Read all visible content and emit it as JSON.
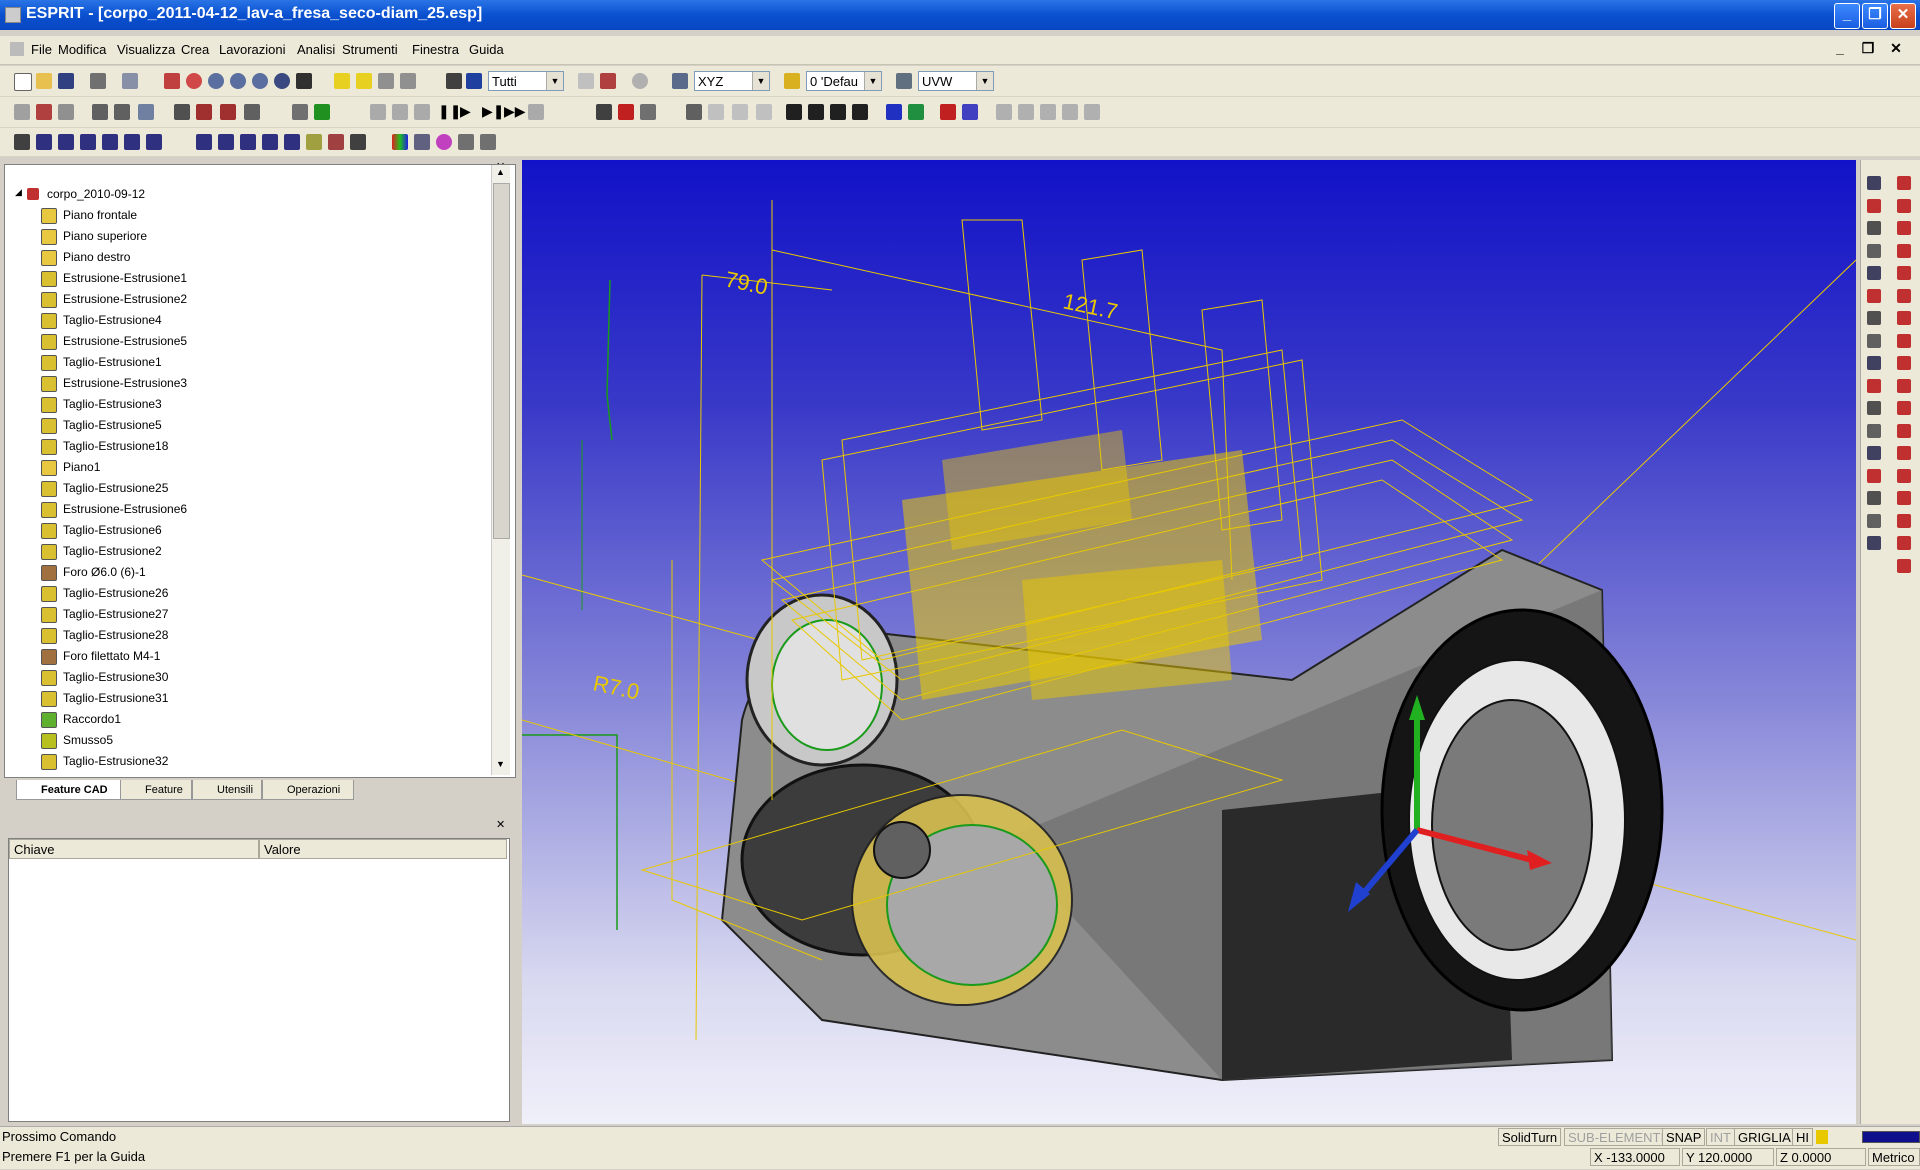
{
  "window": {
    "title": "ESPRIT - [corpo_2011-04-12_lav-a_fresa_seco-diam_25.esp]"
  },
  "menu": [
    "File",
    "Modifica",
    "Visualizza",
    "Crea",
    "Lavorazioni",
    "Analisi",
    "Strumenti",
    "Finestra",
    "Guida"
  ],
  "toolbar": {
    "selection_filter": "Tutti",
    "work_plane": "XYZ",
    "layer": "0 'Defau",
    "uvw": "UVW"
  },
  "tree": {
    "root": "corpo_2010-09-12",
    "items": [
      {
        "label": "Piano frontale",
        "icon": "plane-icon"
      },
      {
        "label": "Piano superiore",
        "icon": "plane-icon"
      },
      {
        "label": "Piano destro",
        "icon": "plane-icon"
      },
      {
        "label": "Estrusione-Estrusione1",
        "icon": "extrude-icon"
      },
      {
        "label": "Estrusione-Estrusione2",
        "icon": "extrude-icon"
      },
      {
        "label": "Taglio-Estrusione4",
        "icon": "cut-extrude-icon"
      },
      {
        "label": "Estrusione-Estrusione5",
        "icon": "extrude-icon"
      },
      {
        "label": "Taglio-Estrusione1",
        "icon": "cut-extrude-icon"
      },
      {
        "label": "Estrusione-Estrusione3",
        "icon": "extrude-icon"
      },
      {
        "label": "Taglio-Estrusione3",
        "icon": "cut-extrude-icon"
      },
      {
        "label": "Taglio-Estrusione5",
        "icon": "cut-extrude-icon"
      },
      {
        "label": "Taglio-Estrusione18",
        "icon": "cut-extrude-icon"
      },
      {
        "label": "Piano1",
        "icon": "plane-icon"
      },
      {
        "label": "Taglio-Estrusione25",
        "icon": "cut-extrude-icon"
      },
      {
        "label": "Estrusione-Estrusione6",
        "icon": "extrude-icon"
      },
      {
        "label": "Taglio-Estrusione6",
        "icon": "cut-extrude-icon"
      },
      {
        "label": "Taglio-Estrusione2",
        "icon": "cut-extrude-icon"
      },
      {
        "label": "Foro Ø6.0 (6)-1",
        "icon": "hole-icon"
      },
      {
        "label": "Taglio-Estrusione26",
        "icon": "cut-extrude-icon"
      },
      {
        "label": "Taglio-Estrusione27",
        "icon": "cut-extrude-icon"
      },
      {
        "label": "Taglio-Estrusione28",
        "icon": "cut-extrude-icon"
      },
      {
        "label": "Foro filettato M4-1",
        "icon": "hole-icon"
      },
      {
        "label": "Taglio-Estrusione30",
        "icon": "cut-extrude-icon"
      },
      {
        "label": "Taglio-Estrusione31",
        "icon": "cut-extrude-icon"
      },
      {
        "label": "Raccordo1",
        "icon": "fillet-icon"
      },
      {
        "label": "Smusso5",
        "icon": "chamfer-icon"
      },
      {
        "label": "Taglio-Estrusione32",
        "icon": "cut-extrude-icon"
      }
    ]
  },
  "tabs": [
    "Feature CAD",
    "Feature",
    "Utensili",
    "Operazioni"
  ],
  "properties": {
    "col_key": "Chiave",
    "col_value": "Valore"
  },
  "viewport": {
    "dim_79": "79.0",
    "dim_121": "121.7",
    "dim_r7": "R7.0"
  },
  "status": {
    "command": "Prossimo Comando",
    "help": "Premere F1 per la Guida",
    "mode": "SolidTurn",
    "sub": "SUB-ELEMENTI",
    "snap": "SNAP",
    "int": "INT",
    "grid": "GRIGLIA",
    "hi": "HI",
    "x": "X -133.0000",
    "y": "Y 120.0000",
    "z": "Z 0.0000",
    "units": "Metrico"
  },
  "colors": {
    "wire": "#e8c800",
    "solid": "#8a8a8a",
    "titlebar": "#0a50d0"
  }
}
